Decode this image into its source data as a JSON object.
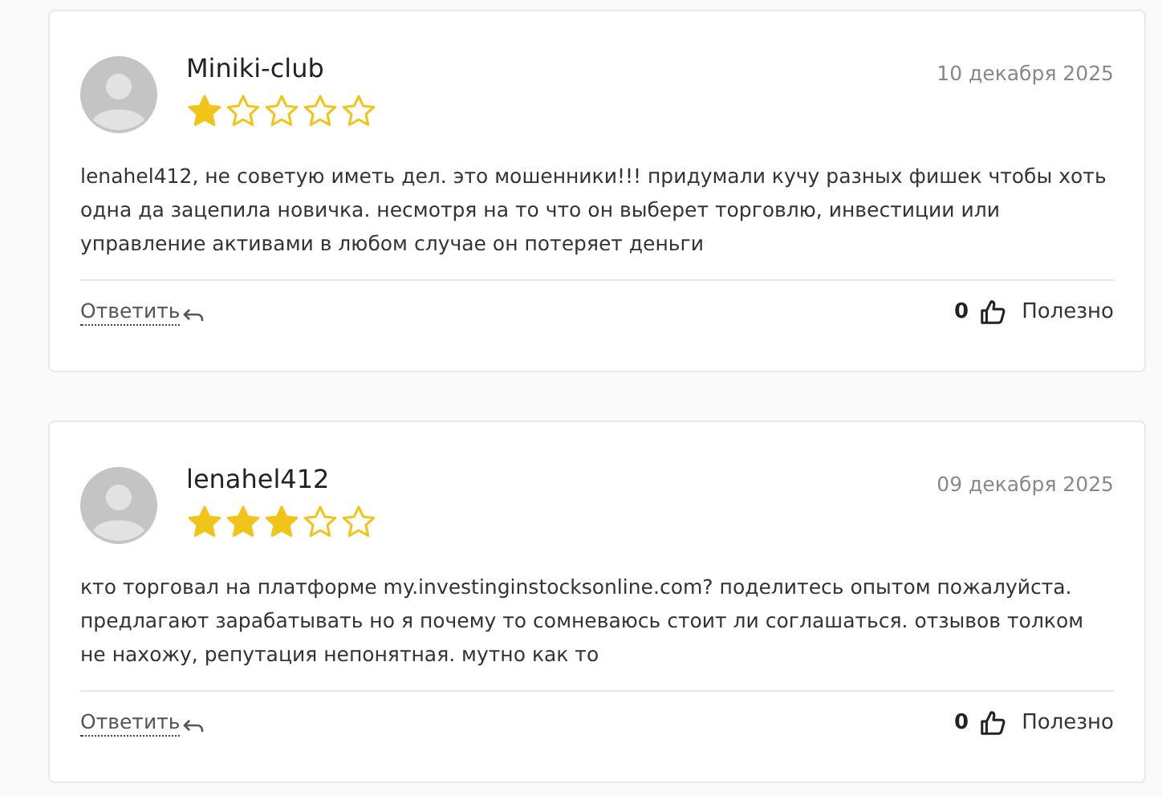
{
  "reviews": [
    {
      "author": "Miniki-club",
      "date": "10 декабря 2025",
      "stars": 1,
      "text": "lenahel412, не советую иметь дел. это мошенники!!! придумали кучу разных фишек чтобы хоть одна да зацепила новичка. несмотря на то что он выберет торговлю, инвестиции или управление активами в любом случае он потеряет деньги",
      "reply": "Ответить",
      "likes": "0",
      "useful": "Полезно"
    },
    {
      "author": "lenahel412",
      "date": "09 декабря 2025",
      "stars": 3,
      "text": "кто торговал на платформе my.investinginstocksonline.com? поделитесь опытом пожалуйста. предлагают зарабатывать но я почему то сомневаюсь стоит ли соглашаться. отзывов толком не нахожу, репутация непонятная. мутно как то",
      "reply": "Ответить",
      "likes": "0",
      "useful": "Полезно"
    }
  ]
}
